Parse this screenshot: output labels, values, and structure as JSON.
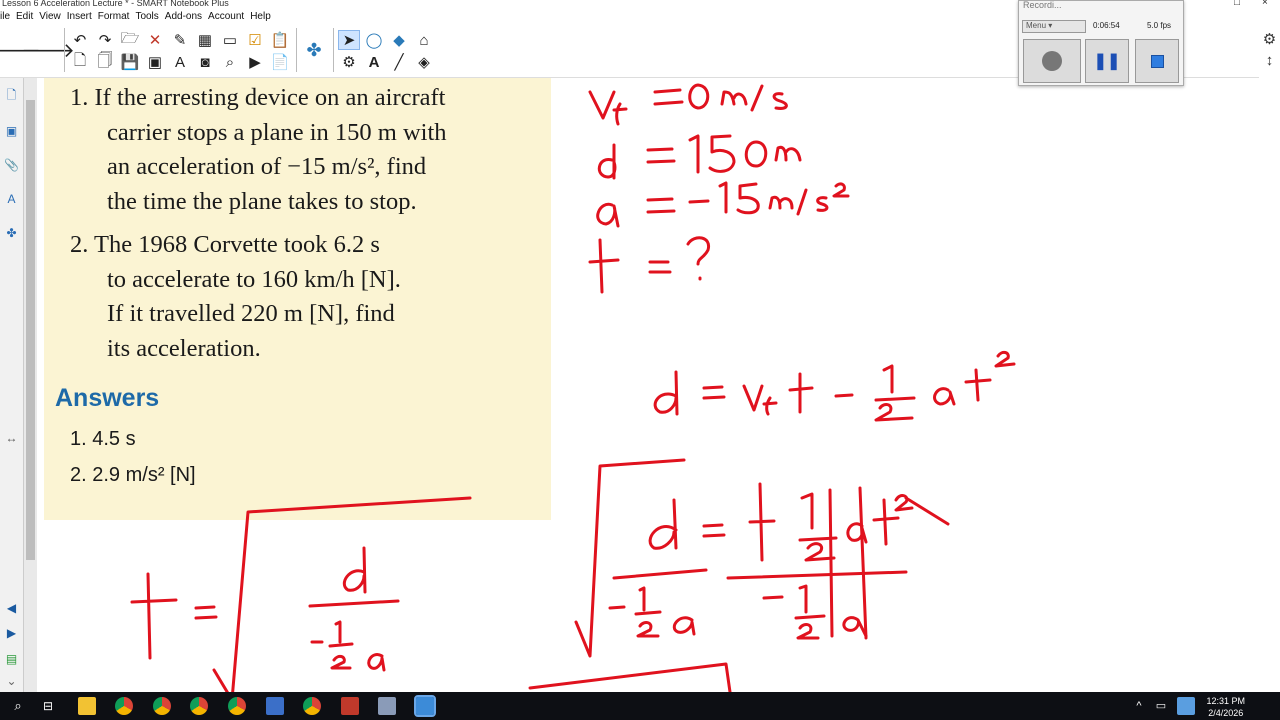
{
  "window": {
    "title": "Lesson 6 Acceleration Lecture * - SMART Notebook Plus"
  },
  "menu": [
    "ile",
    "Edit",
    "View",
    "Insert",
    "Format",
    "Tools",
    "Add-ons",
    "Account",
    "Help"
  ],
  "textbook": {
    "q1_lines": [
      "1.  If the arresting device on an aircraft",
      "carrier stops a plane in 150 m with",
      "an acceleration of −15 m/s², find",
      "the time the plane takes to stop."
    ],
    "q2_lines": [
      "2.  The 1968 Corvette took 6.2 s",
      "to accelerate to 160 km/h [N].",
      "If it travelled 220 m [N], find",
      "its acceleration."
    ],
    "answers_title": "Answers",
    "answers": [
      "1.  4.5 s",
      "2.  2.9 m/s² [N]"
    ]
  },
  "recorder": {
    "title": "Recordi...",
    "menu_label": "Menu",
    "time": "0:06:54",
    "fps": "5.0 fps"
  },
  "taskbar": {
    "time": "12:31 PM",
    "date": "2/4/2026"
  },
  "colors": {
    "ink": "#e0121e",
    "textbook_bg": "#fbf4d3",
    "answers_blue": "#1e6aa8"
  }
}
